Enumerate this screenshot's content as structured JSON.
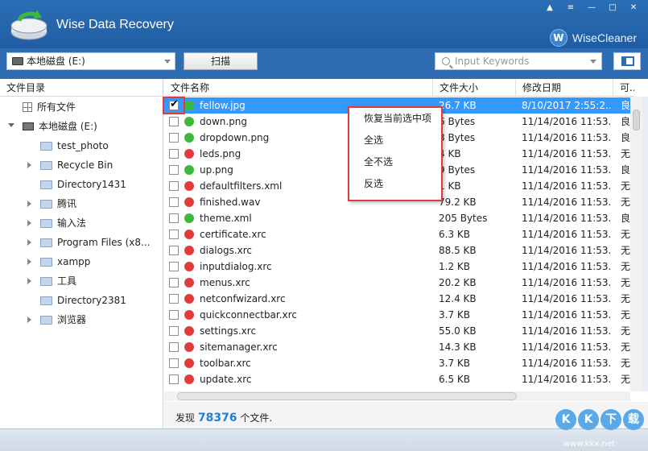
{
  "app": {
    "title": "Wise Data Recovery",
    "brand": "WiseCleaner",
    "brand_icon": "W"
  },
  "toolbar": {
    "drive_value": "本地磁盘 (E:)",
    "scan_label": "扫描",
    "search_placeholder": "Input Keywords"
  },
  "sidebar": {
    "header": "文件目录",
    "items": [
      {
        "label": "所有文件",
        "icon": "grid-icon"
      },
      {
        "label": "本地磁盘 (E:)",
        "icon": "drive-icon"
      },
      {
        "label": "test_photo",
        "icon": "folder-icon"
      },
      {
        "label": "Recycle Bin",
        "icon": "folder-icon"
      },
      {
        "label": "Directory1431",
        "icon": "folder-icon"
      },
      {
        "label": "腾讯",
        "icon": "folder-icon"
      },
      {
        "label": "输入法",
        "icon": "folder-icon"
      },
      {
        "label": "Program Files (x8...",
        "icon": "folder-icon"
      },
      {
        "label": "xampp",
        "icon": "folder-icon"
      },
      {
        "label": "工具",
        "icon": "folder-icon"
      },
      {
        "label": "Directory2381",
        "icon": "folder-icon"
      },
      {
        "label": "浏览器",
        "icon": "folder-icon"
      }
    ]
  },
  "table": {
    "headers": [
      "文件名称",
      "文件大小",
      "修改日期",
      "可..."
    ],
    "rows": [
      {
        "name": "fellow.jpg",
        "size": "26.7 KB",
        "date": "8/10/2017 2:55:2...",
        "status": "良",
        "dot": "#3cb83c",
        "checked": true
      },
      {
        "name": "down.png",
        "size": "6 Bytes",
        "date": "11/14/2016 11:53...",
        "status": "良",
        "dot": "#3cb83c",
        "checked": false
      },
      {
        "name": "dropdown.png",
        "size": "8 Bytes",
        "date": "11/14/2016 11:53...",
        "status": "良",
        "dot": "#3cb83c",
        "checked": false
      },
      {
        "name": "leds.png",
        "size": "4 KB",
        "date": "11/14/2016 11:53...",
        "status": "无",
        "dot": "#e23b3b",
        "checked": false
      },
      {
        "name": "up.png",
        "size": "9 Bytes",
        "date": "11/14/2016 11:53...",
        "status": "良",
        "dot": "#3cb83c",
        "checked": false
      },
      {
        "name": "defaultfilters.xml",
        "size": "1 KB",
        "date": "11/14/2016 11:53...",
        "status": "无",
        "dot": "#e23b3b",
        "checked": false
      },
      {
        "name": "finished.wav",
        "size": "79.2 KB",
        "date": "11/14/2016 11:53...",
        "status": "无",
        "dot": "#e23b3b",
        "checked": false
      },
      {
        "name": "theme.xml",
        "size": "205 Bytes",
        "date": "11/14/2016 11:53...",
        "status": "良",
        "dot": "#3cb83c",
        "checked": false
      },
      {
        "name": "certificate.xrc",
        "size": "6.3 KB",
        "date": "11/14/2016 11:53...",
        "status": "无",
        "dot": "#e23b3b",
        "checked": false
      },
      {
        "name": "dialogs.xrc",
        "size": "88.5 KB",
        "date": "11/14/2016 11:53...",
        "status": "无",
        "dot": "#e23b3b",
        "checked": false
      },
      {
        "name": "inputdialog.xrc",
        "size": "1.2 KB",
        "date": "11/14/2016 11:53...",
        "status": "无",
        "dot": "#e23b3b",
        "checked": false
      },
      {
        "name": "menus.xrc",
        "size": "20.2 KB",
        "date": "11/14/2016 11:53...",
        "status": "无",
        "dot": "#e23b3b",
        "checked": false
      },
      {
        "name": "netconfwizard.xrc",
        "size": "12.4 KB",
        "date": "11/14/2016 11:53...",
        "status": "无",
        "dot": "#e23b3b",
        "checked": false
      },
      {
        "name": "quickconnectbar.xrc",
        "size": "3.7 KB",
        "date": "11/14/2016 11:53...",
        "status": "无",
        "dot": "#e23b3b",
        "checked": false
      },
      {
        "name": "settings.xrc",
        "size": "55.0 KB",
        "date": "11/14/2016 11:53...",
        "status": "无",
        "dot": "#e23b3b",
        "checked": false
      },
      {
        "name": "sitemanager.xrc",
        "size": "14.3 KB",
        "date": "11/14/2016 11:53...",
        "status": "无",
        "dot": "#e23b3b",
        "checked": false
      },
      {
        "name": "toolbar.xrc",
        "size": "3.7 KB",
        "date": "11/14/2016 11:53...",
        "status": "无",
        "dot": "#e23b3b",
        "checked": false
      },
      {
        "name": "update.xrc",
        "size": "6.5 KB",
        "date": "11/14/2016 11:53...",
        "status": "无",
        "dot": "#e23b3b",
        "checked": false
      }
    ]
  },
  "context_menu": {
    "items": [
      "恢复当前选中项",
      "全选",
      "全不选",
      "反选"
    ]
  },
  "status": {
    "prefix": "发现",
    "count": "78376",
    "suffix": "个文件."
  },
  "watermark": {
    "chars": [
      "K",
      "K",
      "下",
      "载"
    ],
    "url": "www.kkx.net"
  }
}
